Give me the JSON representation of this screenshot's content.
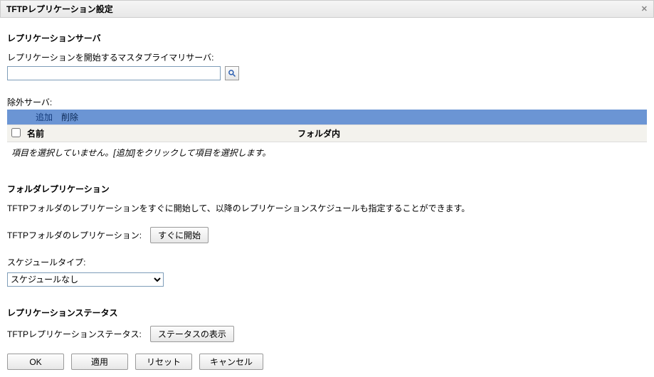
{
  "panel": {
    "title": "TFTPレプリケーション設定"
  },
  "replicationServer": {
    "sectionTitle": "レプリケーションサーバ",
    "masterLabel": "レプリケーションを開始するマスタプライマリサーバ:",
    "masterValue": "",
    "excludeLabel": "除外サーバ:"
  },
  "toolbar": {
    "add": "追加",
    "delete": "削除"
  },
  "grid": {
    "colName": "名前",
    "colFolder": "フォルダ内",
    "emptyText": "項目を選択していません。[追加]をクリックして項目を選択します。"
  },
  "folderReplication": {
    "sectionTitle": "フォルダレプリケーション",
    "description": "TFTPフォルダのレプリケーションをすぐに開始して、以降のレプリケーションスケジュールも指定することができます。",
    "tftpLabel": "TFTPフォルダのレプリケーション:",
    "startNow": "すぐに開始",
    "scheduleTypeLabel": "スケジュールタイプ:",
    "scheduleSelected": "スケジュールなし"
  },
  "status": {
    "sectionTitle": "レプリケーションステータス",
    "label": "TFTPレプリケーションステータス:",
    "showButton": "ステータスの表示"
  },
  "footer": {
    "ok": "OK",
    "apply": "適用",
    "reset": "リセット",
    "cancel": "キャンセル"
  }
}
